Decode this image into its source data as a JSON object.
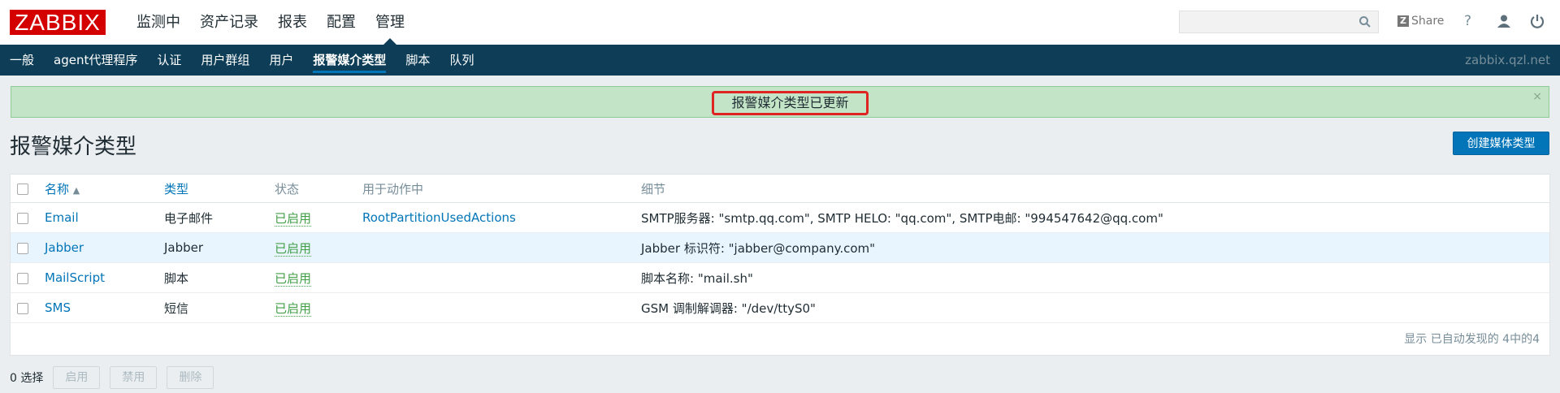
{
  "logo": "ZABBIX",
  "main_nav": [
    "监测中",
    "资产记录",
    "报表",
    "配置",
    "管理"
  ],
  "search": {
    "placeholder": ""
  },
  "header": {
    "share": "Share",
    "help": "?"
  },
  "sub_nav": [
    "一般",
    "agent代理程序",
    "认证",
    "用户群组",
    "用户",
    "报警媒介类型",
    "脚本",
    "队列"
  ],
  "server_name": "zabbix.qzl.net",
  "message": {
    "text": "报警媒介类型已更新",
    "close": "×"
  },
  "page_title": "报警媒介类型",
  "create_button": "创建媒体类型",
  "table": {
    "headers": {
      "name": "名称",
      "sort_arrow": "▲",
      "type": "类型",
      "status": "状态",
      "used_in": "用于动作中",
      "details": "细节"
    },
    "rows": [
      {
        "name": "Email",
        "type": "电子邮件",
        "status": "已启用",
        "used_in": "RootPartitionUsedActions",
        "details": "SMTP服务器: \"smtp.qq.com\", SMTP HELO: \"qq.com\", SMTP电邮: \"994547642@qq.com\""
      },
      {
        "name": "Jabber",
        "type": "Jabber",
        "status": "已启用",
        "used_in": "",
        "details": "Jabber 标识符: \"jabber@company.com\""
      },
      {
        "name": "MailScript",
        "type": "脚本",
        "status": "已启用",
        "used_in": "",
        "details": "脚本名称: \"mail.sh\""
      },
      {
        "name": "SMS",
        "type": "短信",
        "status": "已启用",
        "used_in": "",
        "details": "GSM 调制解调器: \"/dev/ttyS0\""
      }
    ],
    "footer": "显示 已自动发现的 4中的4"
  },
  "bottom": {
    "selected": "0 选择",
    "enable": "启用",
    "disable": "禁用",
    "delete": "删除"
  },
  "colors": {
    "brand": "#d40000",
    "subnav": "#0e3e57",
    "accent": "#0275b8",
    "enabled": "#429e47",
    "message_bg": "#c3e4c6",
    "highlight": "#e02323"
  }
}
